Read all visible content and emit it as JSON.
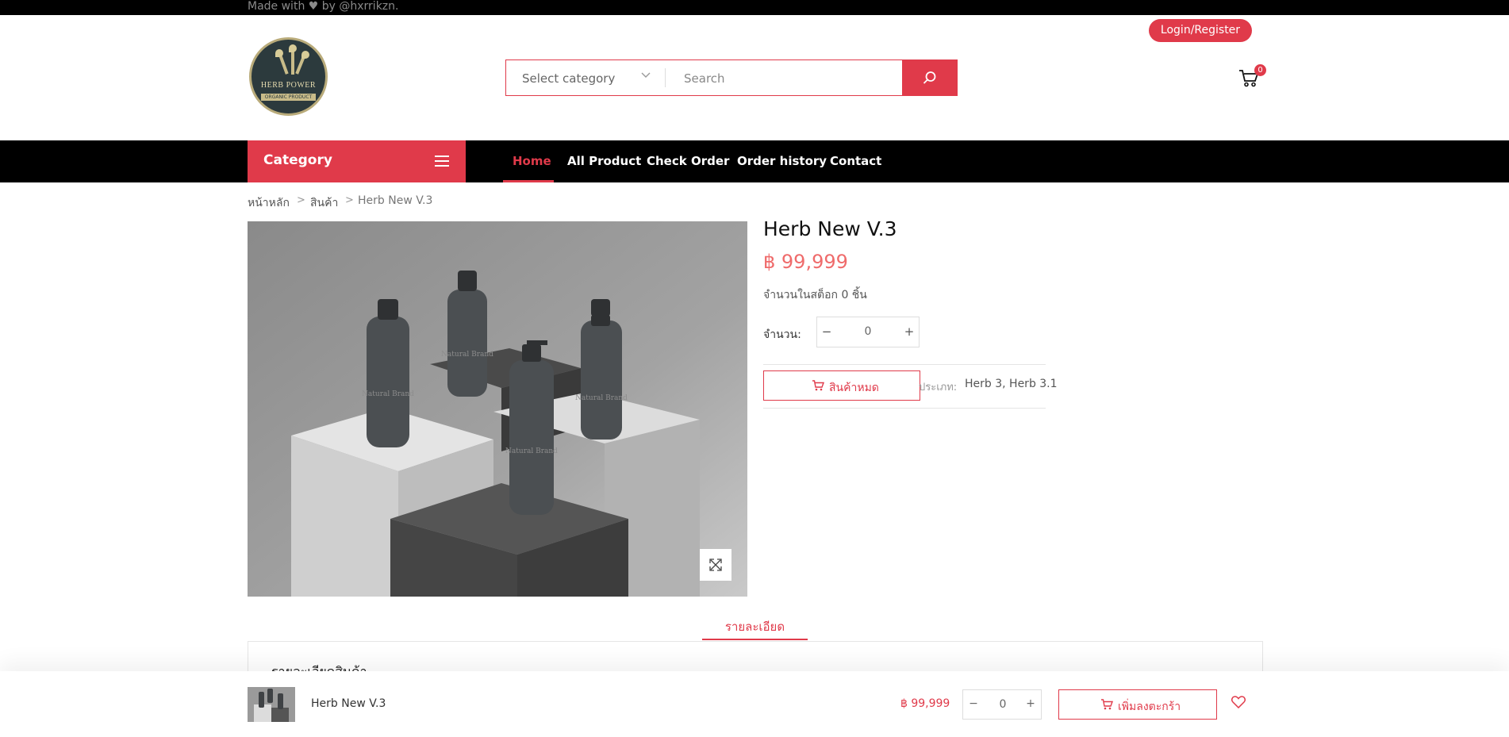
{
  "topbar": {
    "text": "Made with ♥ by @hxrrikzn."
  },
  "logo": {
    "name": "HERB POWER",
    "tagline": "ORGANIC PRODUCT"
  },
  "search": {
    "category_label": "Select category",
    "placeholder": "Search"
  },
  "auth": {
    "login_label": "Login/Register"
  },
  "cart": {
    "count": "0"
  },
  "nav": {
    "category_label": "Category",
    "links": [
      "Home",
      "All Product",
      "Check Order",
      "Order history",
      "Contact"
    ],
    "active": "Home"
  },
  "breadcrumb": [
    "หน้าหลัก",
    "สินค้า",
    "Herb New V.3"
  ],
  "product": {
    "title": "Herb New V.3",
    "price": "฿ 99,999",
    "stock_text": "จำนวนในสต็อก 0 ชิ้น",
    "qty_label": "จำนวน:",
    "qty_minus": "−",
    "qty_value": "0",
    "qty_plus": "+",
    "soldout_label": "สินค้าหมด",
    "type_label": "ประเภท:",
    "type_value": "Herb 3, Herb 3.1",
    "image_text": "Natural Brand"
  },
  "tabs": {
    "details_label": "รายละเอียด",
    "panel_heading": "รายละเอียดสินค้า"
  },
  "sticky": {
    "name": "Herb New V.3",
    "price": "฿ 99,999",
    "qty_minus": "−",
    "qty_value": "0",
    "qty_plus": "+",
    "add_label": "เพิ่มลงตะกร้า"
  },
  "colors": {
    "accent": "#e03a4a",
    "nav_bg": "#000000",
    "price": "#ef6b6b"
  }
}
